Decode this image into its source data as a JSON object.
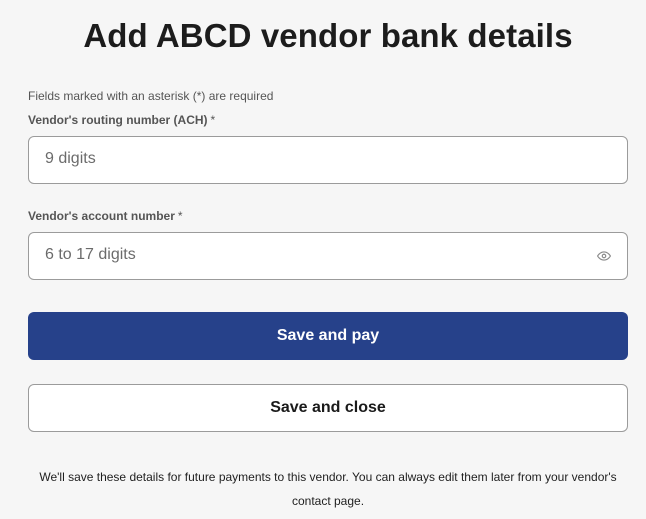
{
  "form": {
    "title": "Add ABCD vendor bank details",
    "required_note": "Fields marked with an asterisk (*) are required",
    "routing": {
      "label": "Vendor's routing number (ACH)",
      "required_mark": "*",
      "value": "",
      "placeholder": "9 digits"
    },
    "account": {
      "label": "Vendor's account number",
      "required_mark": "*",
      "value": "",
      "placeholder": "6 to 17 digits",
      "toggle_icon": "eye-icon"
    },
    "primary_button": "Save and pay",
    "secondary_button": "Save and close",
    "footer_note": "We'll save these details for future payments to this vendor. You can always edit them later from your vendor's contact page."
  },
  "colors": {
    "primary": "#26418a",
    "background": "#f6f6f6",
    "border": "#9b9b9b"
  }
}
